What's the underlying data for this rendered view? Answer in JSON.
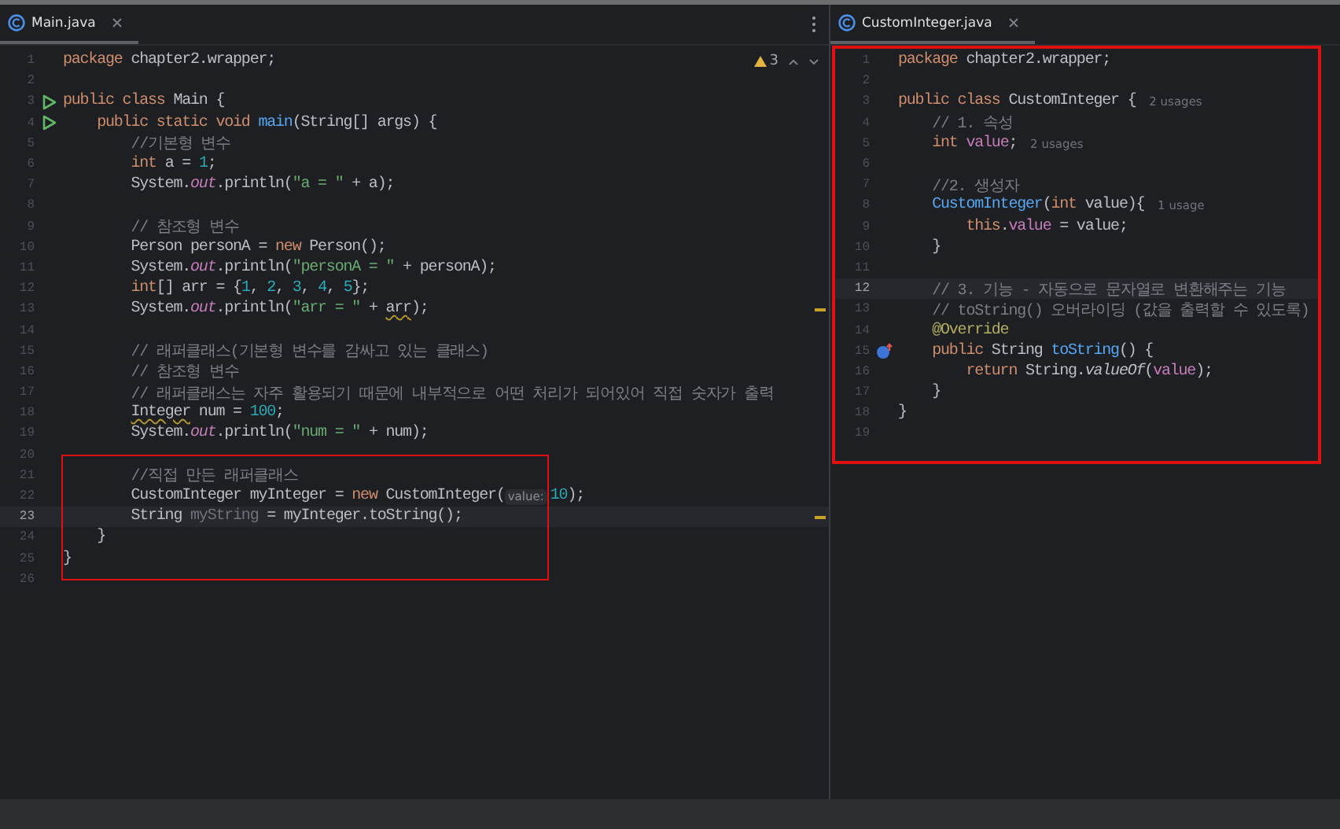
{
  "panes": [
    {
      "tab": {
        "label": "Main.java",
        "selected": true,
        "closable": true
      },
      "menu_button": true,
      "inspection": {
        "count": "3"
      },
      "lines": [
        {
          "number": "1",
          "tokens": [
            {
              "kind": "kw",
              "text": "package"
            },
            {
              "kind": "plain",
              "text": " chapter2.wrapper;"
            }
          ]
        },
        {
          "number": "2"
        },
        {
          "number": "3",
          "gutter": {
            "kind": "run"
          },
          "tokens": [
            {
              "kind": "kw",
              "text": "public class"
            },
            {
              "kind": "plain",
              "text": " Main {"
            }
          ]
        },
        {
          "number": "4",
          "gutter": {
            "kind": "run"
          },
          "tokens": [
            {
              "kind": "kw",
              "text": "    public static void "
            },
            {
              "kind": "fn",
              "text": "main"
            },
            {
              "kind": "plain",
              "text": "(String[] args) {"
            }
          ]
        },
        {
          "number": "5",
          "tokens": [
            {
              "kind": "comment",
              "text": "        //기본형 변수"
            }
          ]
        },
        {
          "number": "6",
          "tokens": [
            {
              "kind": "kw",
              "text": "        int"
            },
            {
              "kind": "plain",
              "text": " a = "
            },
            {
              "kind": "num",
              "text": "1"
            },
            {
              "kind": "plain",
              "text": ";"
            }
          ]
        },
        {
          "number": "7",
          "tokens": [
            {
              "kind": "plain",
              "text": "        System."
            },
            {
              "kind": "static",
              "text": "out"
            },
            {
              "kind": "plain",
              "text": ".println("
            },
            {
              "kind": "str",
              "text": "\"a = \""
            },
            {
              "kind": "plain",
              "text": " + a);"
            }
          ]
        },
        {
          "number": "8"
        },
        {
          "number": "9",
          "tokens": [
            {
              "kind": "comment",
              "text": "        // 참조형 변수"
            }
          ]
        },
        {
          "number": "10",
          "tokens": [
            {
              "kind": "plain",
              "text": "        Person personA = "
            },
            {
              "kind": "kw",
              "text": "new"
            },
            {
              "kind": "plain",
              "text": " Person();"
            }
          ]
        },
        {
          "number": "11",
          "tokens": [
            {
              "kind": "plain",
              "text": "        System."
            },
            {
              "kind": "static",
              "text": "out"
            },
            {
              "kind": "plain",
              "text": ".println("
            },
            {
              "kind": "str",
              "text": "\"personA = \""
            },
            {
              "kind": "plain",
              "text": " + personA);"
            }
          ]
        },
        {
          "number": "12",
          "tokens": [
            {
              "kind": "kw",
              "text": "        int"
            },
            {
              "kind": "plain",
              "text": "[] arr = {"
            },
            {
              "kind": "num",
              "text": "1"
            },
            {
              "kind": "plain",
              "text": ", "
            },
            {
              "kind": "num",
              "text": "2"
            },
            {
              "kind": "plain",
              "text": ", "
            },
            {
              "kind": "num",
              "text": "3"
            },
            {
              "kind": "plain",
              "text": ", "
            },
            {
              "kind": "num",
              "text": "4"
            },
            {
              "kind": "plain",
              "text": ", "
            },
            {
              "kind": "num",
              "text": "5"
            },
            {
              "kind": "plain",
              "text": "};"
            }
          ]
        },
        {
          "number": "13",
          "stripe_mark": true,
          "tokens": [
            {
              "kind": "plain",
              "text": "        System."
            },
            {
              "kind": "static",
              "text": "out"
            },
            {
              "kind": "plain",
              "text": ".println("
            },
            {
              "kind": "str",
              "text": "\"arr = \""
            },
            {
              "kind": "plain",
              "text": " + "
            },
            {
              "kind": "warn",
              "text": "arr"
            },
            {
              "kind": "plain",
              "text": ");"
            }
          ]
        },
        {
          "number": "14"
        },
        {
          "number": "15",
          "tokens": [
            {
              "kind": "comment",
              "text": "        // 래퍼클래스(기본형 변수를 감싸고 있는 클래스)"
            }
          ]
        },
        {
          "number": "16",
          "tokens": [
            {
              "kind": "comment",
              "text": "        // 참조형 변수"
            }
          ]
        },
        {
          "number": "17",
          "tokens": [
            {
              "kind": "comment",
              "text": "        // 래퍼클래스는 자주 활용되기 때문에 내부적으로 어떤 처리가 되어있어 직접 숫자가 출력"
            }
          ]
        },
        {
          "number": "18",
          "tokens": [
            {
              "kind": "warn",
              "text": "        Integer"
            },
            {
              "kind": "plain",
              "text": " num = "
            },
            {
              "kind": "num",
              "text": "100"
            },
            {
              "kind": "plain",
              "text": ";"
            }
          ]
        },
        {
          "number": "19",
          "tokens": [
            {
              "kind": "plain",
              "text": "        System."
            },
            {
              "kind": "static",
              "text": "out"
            },
            {
              "kind": "plain",
              "text": ".println("
            },
            {
              "kind": "str",
              "text": "\"num = \""
            },
            {
              "kind": "plain",
              "text": " + num);"
            }
          ]
        },
        {
          "number": "20"
        },
        {
          "number": "21",
          "boxed": true,
          "tokens": [
            {
              "kind": "comment",
              "text": "        //직접 만든 래퍼클래스"
            }
          ]
        },
        {
          "number": "22",
          "boxed": true,
          "tokens": [
            {
              "kind": "plain",
              "text": "        CustomInteger myInteger = "
            },
            {
              "kind": "kw",
              "text": "new"
            },
            {
              "kind": "plain",
              "text": " CustomInteger("
            },
            {
              "kind": "hint",
              "text": "value:"
            },
            {
              "kind": "num",
              "text": "10"
            },
            {
              "kind": "plain",
              "text": ");"
            }
          ]
        },
        {
          "number": "23",
          "boxed": true,
          "current": true,
          "stripe_mark": true,
          "tokens": [
            {
              "kind": "plain",
              "text": "        String "
            },
            {
              "kind": "muted",
              "text": "myString"
            },
            {
              "kind": "plain",
              "text": " = myInteger.toString();"
            }
          ]
        },
        {
          "number": "24",
          "boxed": true,
          "tokens": [
            {
              "kind": "plain",
              "text": "    }"
            }
          ]
        },
        {
          "number": "25",
          "boxed": true,
          "tokens": [
            {
              "kind": "plain",
              "text": "}"
            }
          ]
        },
        {
          "number": "26"
        }
      ]
    },
    {
      "tab": {
        "label": "CustomInteger.java",
        "selected": true,
        "closable": true
      },
      "highlighted": true,
      "lines": [
        {
          "number": "1",
          "tokens": [
            {
              "kind": "kw",
              "text": "package"
            },
            {
              "kind": "plain",
              "text": " chapter2.wrapper;"
            }
          ]
        },
        {
          "number": "2"
        },
        {
          "number": "3",
          "tokens": [
            {
              "kind": "kw",
              "text": "public class"
            },
            {
              "kind": "plain",
              "text": " CustomInteger { "
            },
            {
              "kind": "usage",
              "text": "2 usages"
            }
          ]
        },
        {
          "number": "4",
          "tokens": [
            {
              "kind": "comment",
              "text": "    // 1. 속성"
            }
          ]
        },
        {
          "number": "5",
          "tokens": [
            {
              "kind": "kw",
              "text": "    int "
            },
            {
              "kind": "field",
              "text": "value"
            },
            {
              "kind": "plain",
              "text": "; "
            },
            {
              "kind": "usage",
              "text": "2 usages"
            }
          ]
        },
        {
          "number": "6"
        },
        {
          "number": "7",
          "tokens": [
            {
              "kind": "comment",
              "text": "    //2. 생성자"
            }
          ]
        },
        {
          "number": "8",
          "tokens": [
            {
              "kind": "fn",
              "text": "    CustomInteger"
            },
            {
              "kind": "plain",
              "text": "("
            },
            {
              "kind": "kw",
              "text": "int"
            },
            {
              "kind": "plain",
              "text": " value){ "
            },
            {
              "kind": "usage",
              "text": "1 usage"
            }
          ]
        },
        {
          "number": "9",
          "tokens": [
            {
              "kind": "kw",
              "text": "        this"
            },
            {
              "kind": "plain",
              "text": "."
            },
            {
              "kind": "field",
              "text": "value"
            },
            {
              "kind": "plain",
              "text": " = value;"
            }
          ]
        },
        {
          "number": "10",
          "tokens": [
            {
              "kind": "plain",
              "text": "    }"
            }
          ]
        },
        {
          "number": "11"
        },
        {
          "number": "12",
          "current": true,
          "tokens": [
            {
              "kind": "comment",
              "text": "    // 3. 기능 - 자동으로 문자열로 변환해주는 기능"
            }
          ]
        },
        {
          "number": "13",
          "tokens": [
            {
              "kind": "comment",
              "text": "    // toString() 오버라이딩 (값을 출력할 수 있도록)"
            }
          ]
        },
        {
          "number": "14",
          "tokens": [
            {
              "kind": "ann",
              "text": "    @Override"
            }
          ]
        },
        {
          "number": "15",
          "gutter": {
            "kind": "override"
          },
          "tokens": [
            {
              "kind": "kw",
              "text": "    public"
            },
            {
              "kind": "plain",
              "text": " String "
            },
            {
              "kind": "fn",
              "text": "toString"
            },
            {
              "kind": "plain",
              "text": "() {"
            }
          ]
        },
        {
          "number": "16",
          "tokens": [
            {
              "kind": "kw",
              "text": "        return"
            },
            {
              "kind": "plain",
              "text": " String."
            },
            {
              "kind": "italic",
              "text": "valueOf"
            },
            {
              "kind": "plain",
              "text": "("
            },
            {
              "kind": "field",
              "text": "value"
            },
            {
              "kind": "plain",
              "text": ");"
            }
          ]
        },
        {
          "number": "17",
          "tokens": [
            {
              "kind": "plain",
              "text": "    }"
            }
          ]
        },
        {
          "number": "18",
          "tokens": [
            {
              "kind": "plain",
              "text": "}"
            }
          ]
        },
        {
          "number": "19"
        }
      ]
    }
  ]
}
